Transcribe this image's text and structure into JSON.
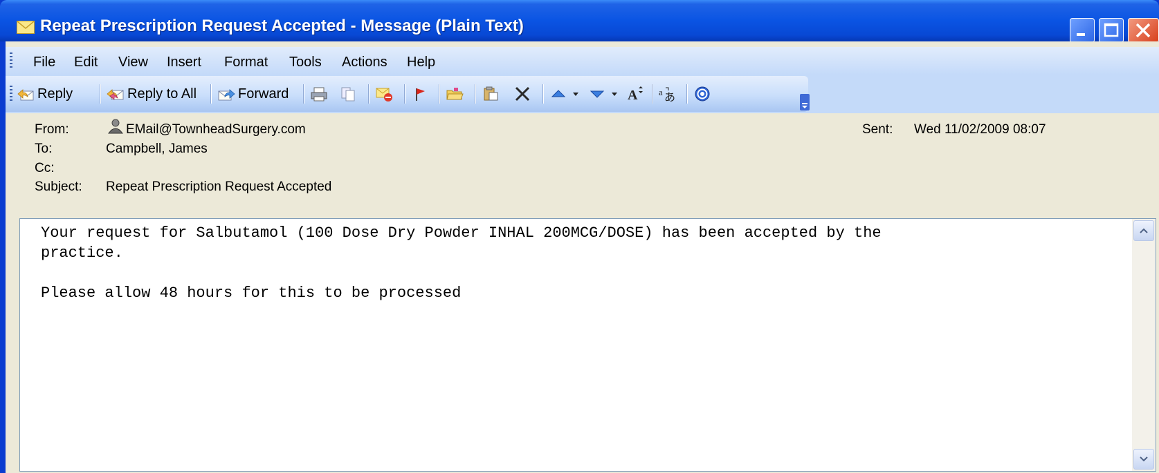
{
  "window": {
    "title": "Repeat Prescription Request Accepted - Message (Plain Text)"
  },
  "menu": {
    "items": [
      "File",
      "Edit",
      "View",
      "Insert",
      "Format",
      "Tools",
      "Actions",
      "Help"
    ]
  },
  "toolbar": {
    "reply": "Reply",
    "reply_all": "Reply to All",
    "forward": "Forward"
  },
  "headers": {
    "from_label": "From:",
    "from_value": "EMail@TownheadSurgery.com",
    "to_label": "To:",
    "to_value": "Campbell, James",
    "cc_label": "Cc:",
    "cc_value": "",
    "subject_label": "Subject:",
    "subject_value": "Repeat Prescription Request Accepted",
    "sent_label": "Sent:",
    "sent_value": "Wed 11/02/2009 08:07"
  },
  "message": {
    "body": "Your request for Salbutamol (100 Dose Dry Powder INHAL 200MCG/DOSE) has been accepted by the\npractice.\n\nPlease allow 48 hours for this to be processed"
  },
  "colors": {
    "titlebar": "#0a54e3",
    "client": "#ece9d8",
    "menubar": "#c4daf9"
  }
}
